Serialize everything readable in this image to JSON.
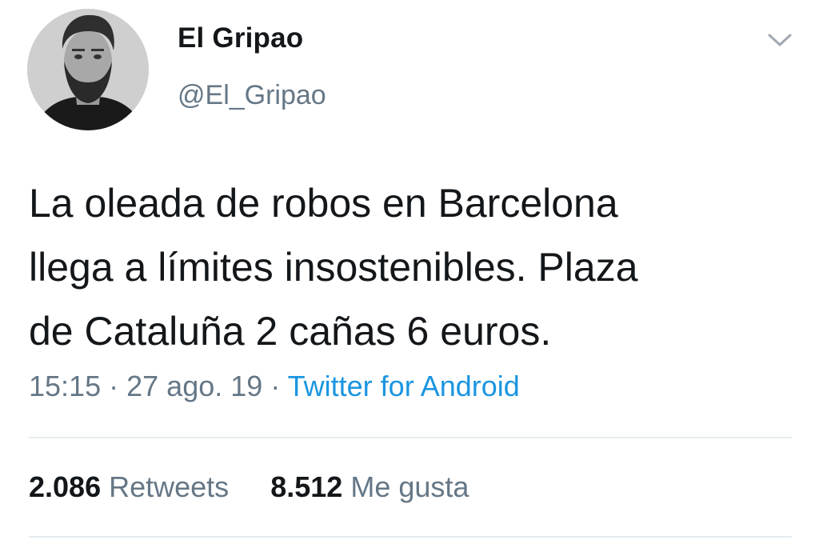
{
  "author": {
    "display_name": "El Gripao",
    "handle": "@El_Gripao",
    "avatar_icon": "profile-photo"
  },
  "tweet": {
    "lines": [
      "La oleada de robos en Barcelona",
      "llega a límites insostenibles. Plaza",
      "de Cataluña 2 cañas 6 euros."
    ],
    "time": "15:15",
    "date": "27 ago. 19",
    "separator": "·",
    "source": "Twitter for Android"
  },
  "stats": {
    "retweets_count": "2.086",
    "retweets_label": "Retweets",
    "likes_count": "8.512",
    "likes_label": "Me gusta"
  },
  "icons": {
    "menu": "chevron-down-icon"
  },
  "colors": {
    "text_primary": "#14171a",
    "text_secondary": "#657786",
    "link": "#1b95e0",
    "divider": "#e6ecf0"
  }
}
